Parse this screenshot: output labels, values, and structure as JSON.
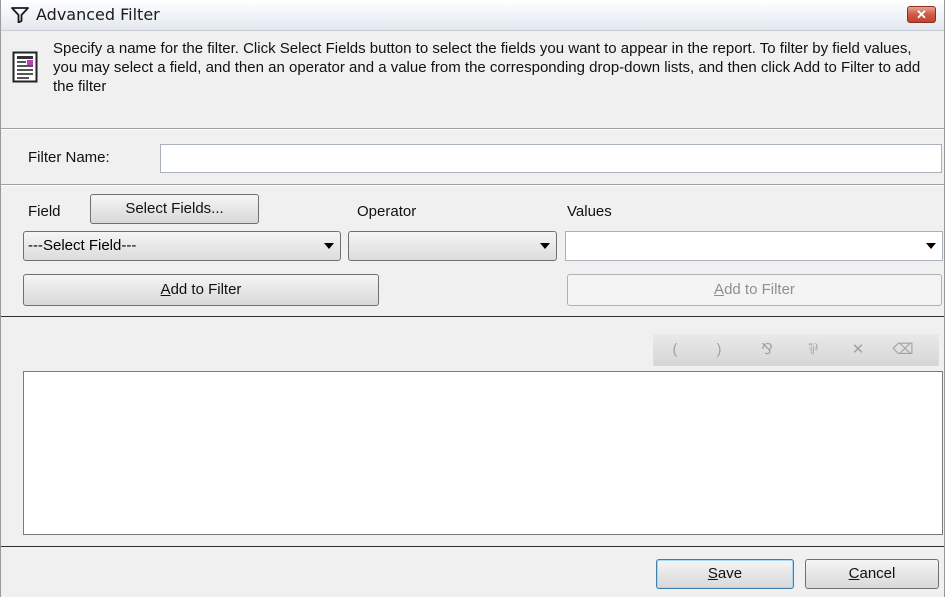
{
  "window": {
    "title": "Advanced Filter",
    "close_label": "✕"
  },
  "info": {
    "text": "Specify a name for the filter. Click Select Fields button to select the fields you want to appear in the report. To filter by field values, you may select a field, and then an operator and a value from the corresponding drop-down lists, and then click Add to Filter to add the filter"
  },
  "filter_name": {
    "label": "Filter Name:",
    "value": ""
  },
  "criteria": {
    "field_label": "Field",
    "select_fields_label": "Select Fields...",
    "operator_label": "Operator",
    "values_label": "Values",
    "field_selected": "---Select Field---",
    "operator_selected": "",
    "values_selected": "",
    "add_to_filter": {
      "mnemonic": "A",
      "rest": "dd to Filter"
    },
    "add_to_filter_values": {
      "mnemonic": "A",
      "rest": "dd to Filter"
    }
  },
  "toolbar": {
    "items": [
      {
        "name": "open-paren",
        "glyph": "("
      },
      {
        "name": "close-paren",
        "glyph": ")"
      },
      {
        "name": "and-icon",
        "glyph": "⅋"
      },
      {
        "name": "or-icon",
        "glyph": "⅌"
      },
      {
        "name": "remove-icon",
        "glyph": "✕"
      },
      {
        "name": "clear-all-icon",
        "glyph": "⌫"
      }
    ]
  },
  "footer": {
    "save": {
      "mnemonic": "S",
      "rest": "ave"
    },
    "cancel": {
      "mnemonic": "C",
      "rest": "ancel"
    }
  }
}
